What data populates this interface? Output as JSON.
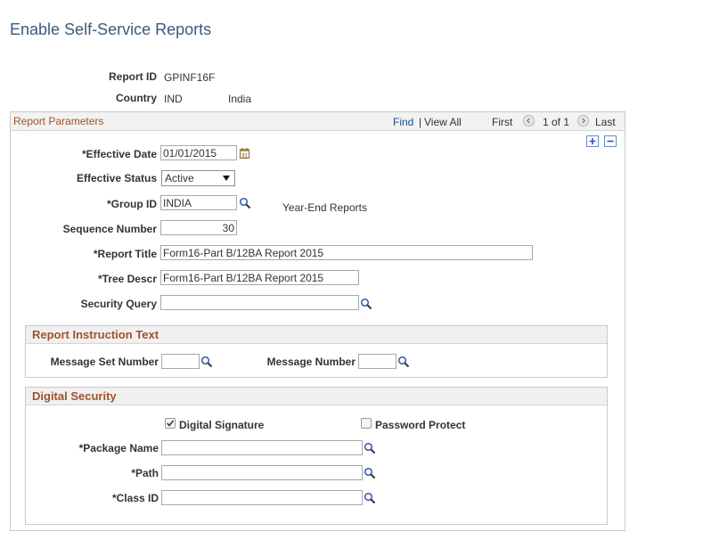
{
  "page": {
    "title": "Enable Self-Service Reports"
  },
  "header": {
    "report_id_label": "Report ID",
    "report_id_value": "GPINF16F",
    "country_label": "Country",
    "country_code": "IND",
    "country_name": "India"
  },
  "report_params": {
    "title": "Report Parameters",
    "nav": {
      "find": "Find",
      "separator": "|",
      "view_all": "View All",
      "first": "First",
      "count": "1 of 1",
      "last": "Last"
    },
    "effective_date": {
      "label": "*Effective Date",
      "value": "01/01/2015"
    },
    "effective_status": {
      "label": "Effective Status",
      "value": "Active"
    },
    "group_id": {
      "label": "*Group ID",
      "value": "INDIA",
      "description": "Year-End Reports"
    },
    "sequence_number": {
      "label": "Sequence Number",
      "value": "30"
    },
    "report_title": {
      "label": "*Report Title",
      "value": "Form16-Part B/12BA Report 2015"
    },
    "tree_descr": {
      "label": "*Tree Descr",
      "value": "Form16-Part B/12BA Report 2015"
    },
    "security_query": {
      "label": "Security Query",
      "value": ""
    }
  },
  "instruction_text": {
    "title": "Report Instruction Text",
    "message_set_label": "Message Set Number",
    "message_set_value": "",
    "message_number_label": "Message Number",
    "message_number_value": ""
  },
  "digital_security": {
    "title": "Digital Security",
    "digital_signature_label": "Digital Signature",
    "digital_signature_checked": true,
    "password_protect_label": "Password Protect",
    "password_protect_checked": false,
    "package_name": {
      "label": "*Package Name",
      "value": ""
    },
    "path": {
      "label": "*Path",
      "value": ""
    },
    "class_id": {
      "label": "*Class ID",
      "value": ""
    }
  },
  "colors": {
    "title_blue": "#3b5a7d",
    "section_brown": "#a0522d",
    "link_blue": "#1a4f8c"
  }
}
